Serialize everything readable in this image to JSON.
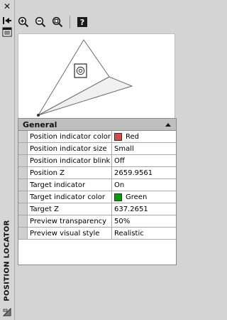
{
  "window": {
    "title": "POSITION LOCATOR"
  },
  "toolbar": {
    "buttons": [
      {
        "name": "zoom-in",
        "icon": "zoom-in-icon"
      },
      {
        "name": "zoom-out",
        "icon": "zoom-out-icon"
      },
      {
        "name": "zoom-extents",
        "icon": "zoom-extents-icon"
      },
      {
        "name": "help",
        "icon": "help-icon"
      }
    ]
  },
  "properties": {
    "section": "General",
    "rows": [
      {
        "label": "Position indicator color",
        "value": "Red",
        "swatch": "#d84a4a"
      },
      {
        "label": "Position indicator size",
        "value": "Small"
      },
      {
        "label": "Position indicator blink",
        "value": "Off"
      },
      {
        "label": "Position Z",
        "value": "2659.9561"
      },
      {
        "label": "Target indicator",
        "value": "On"
      },
      {
        "label": "Target indicator color",
        "value": "Green",
        "swatch": "#00a000"
      },
      {
        "label": "Target Z",
        "value": "637.2651"
      },
      {
        "label": "Preview transparency",
        "value": "50%"
      },
      {
        "label": "Preview visual style",
        "value": "Realistic"
      }
    ]
  }
}
